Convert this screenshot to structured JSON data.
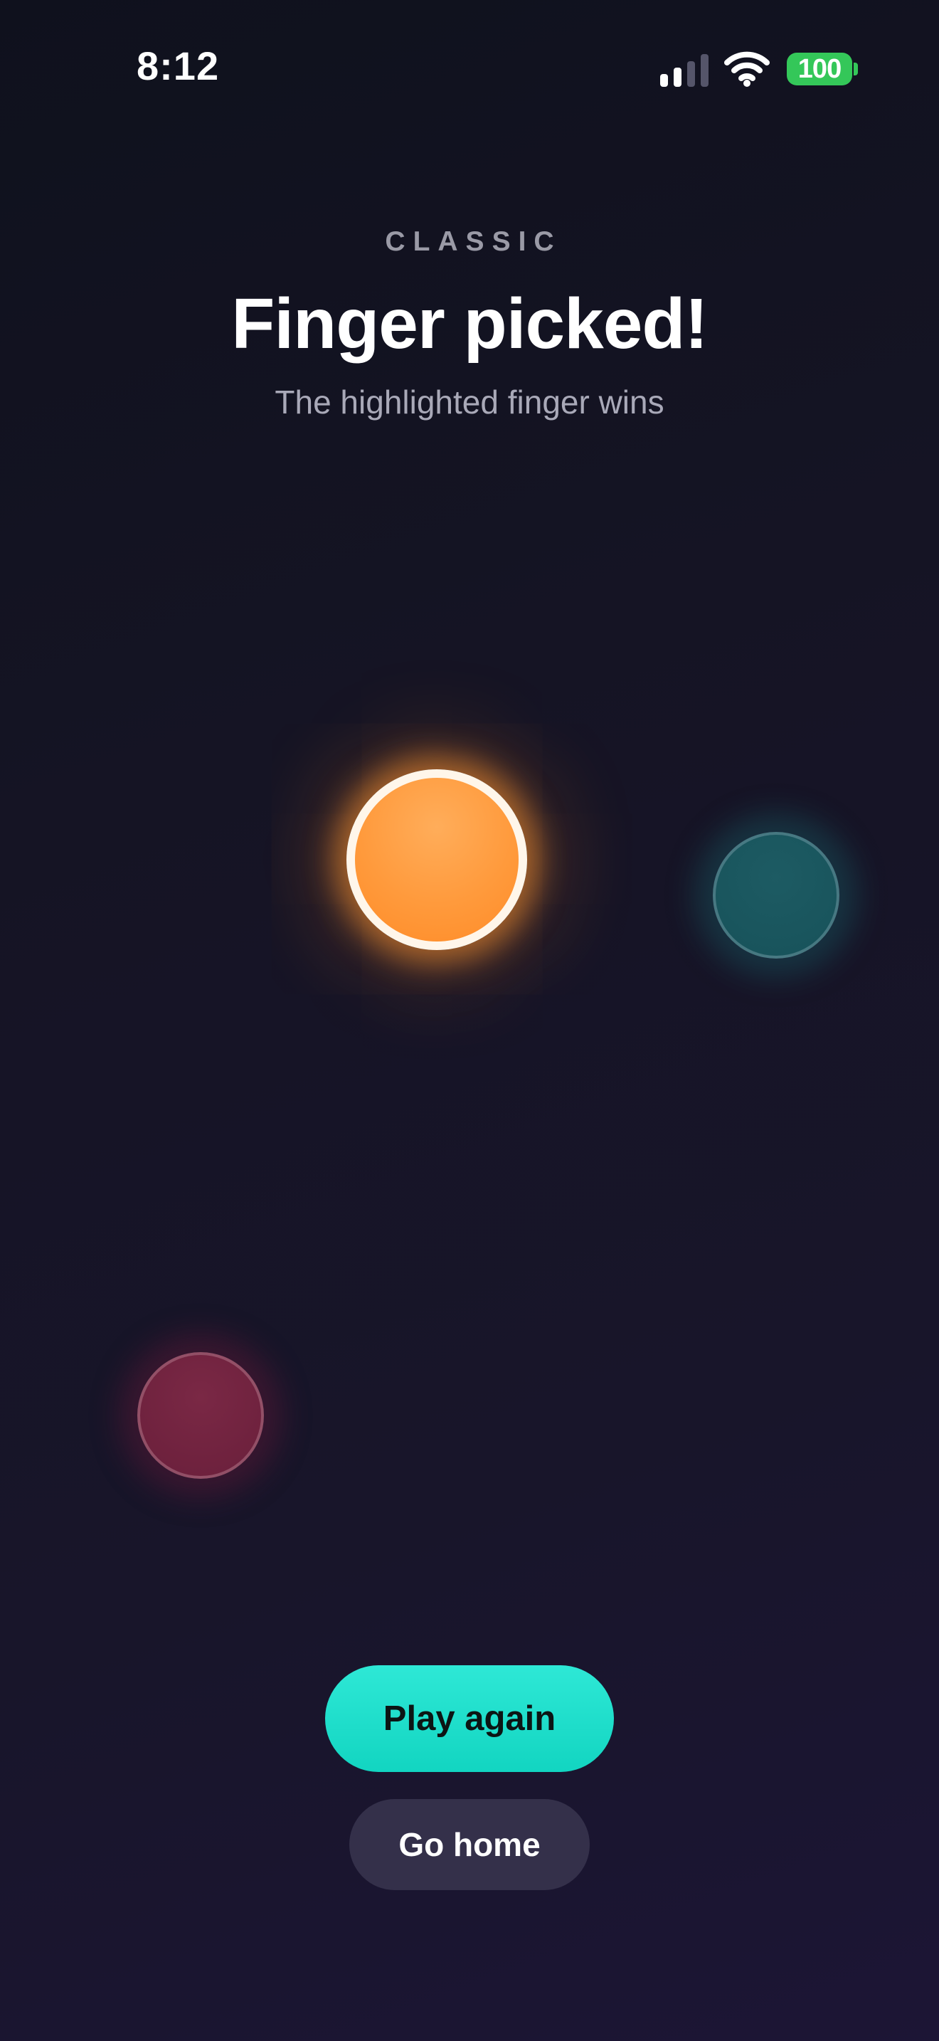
{
  "status_bar": {
    "time": "8:12",
    "signal_icon": "cellular-signal-icon",
    "wifi_icon": "wifi-icon",
    "battery_level": "100",
    "battery_color": "#34c759"
  },
  "header": {
    "mode": "CLASSIC",
    "title": "Finger picked!",
    "subtitle": "The highlighted finger wins"
  },
  "fingers": [
    {
      "name": "winner",
      "color": "#ff9a3c",
      "selected": true
    },
    {
      "name": "teal",
      "color": "#17525a",
      "selected": false
    },
    {
      "name": "red",
      "color": "#6a1f3b",
      "selected": false
    }
  ],
  "actions": {
    "primary_label": "Play again",
    "primary_color": "#12d5c1",
    "secondary_label": "Go home",
    "secondary_color": "#34304a"
  }
}
